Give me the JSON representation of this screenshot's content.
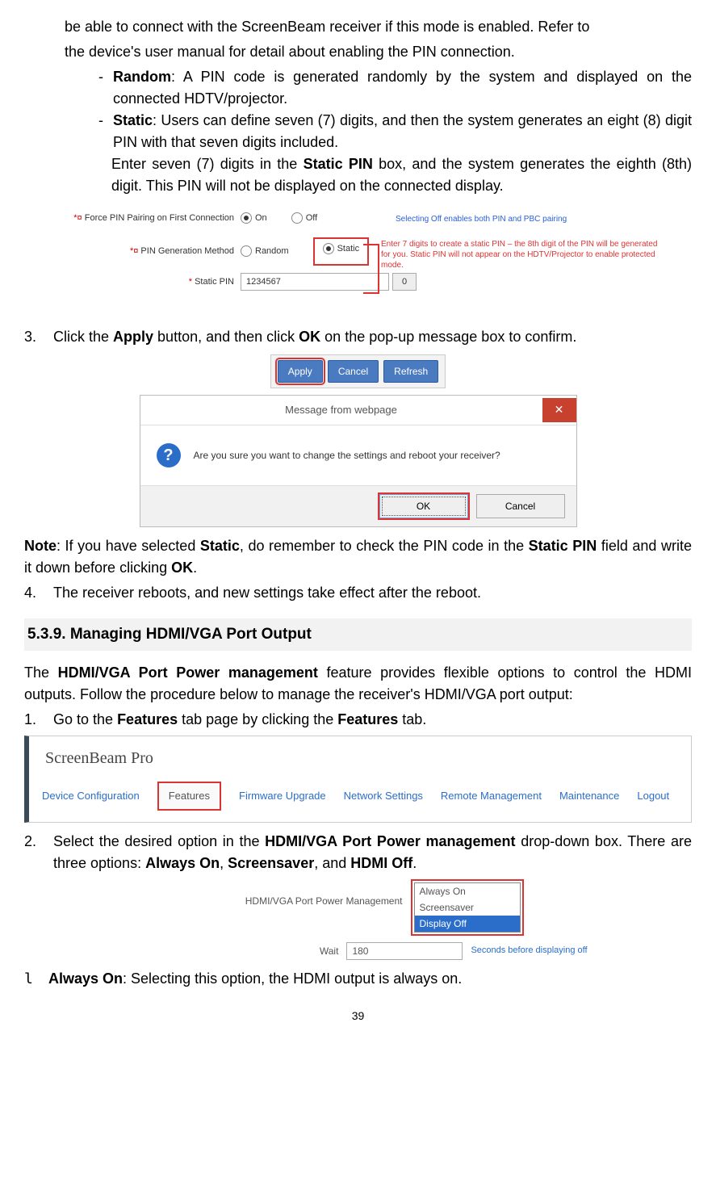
{
  "intro": {
    "line1": "be able to connect with the ScreenBeam receiver if this mode is enabled. Refer to",
    "line2": "the device's user manual for detail about enabling the PIN connection."
  },
  "random": {
    "dash": "-",
    "label": "Random",
    "text": ": A PIN code is generated randomly by the system and displayed on the connected HDTV/projector."
  },
  "static": {
    "dash": "-",
    "label": "Static",
    "text1": ": Users can define seven (7) digits, and then the system generates an eight (8) digit PIN with that seven digits included.",
    "text2a": "Enter seven (7) digits in the ",
    "boxlabel": "Static PIN",
    "text2b": " box, and the system generates the eighth (8th) digit. This PIN will not be displayed on the connected display."
  },
  "pinfig": {
    "row1label": "Force PIN Pairing on First Connection",
    "on": "On",
    "off": "Off",
    "bluenote": "Selecting Off enables both PIN and PBC pairing",
    "row2label": "PIN Generation Method",
    "random": "Random",
    "static": "Static",
    "row3label": "Static PIN",
    "pinval": "1234567",
    "eighth": "0",
    "redtext": "Enter 7 digits to create a static PIN – the 8th digit of the PIN will be generated for you. Static PIN will not appear on the HDTV/Projector to enable protected mode."
  },
  "step3": {
    "num": "3.",
    "a": "Click the ",
    "apply": "Apply",
    "b": " button, and then click ",
    "ok": "OK",
    "c": " on the pop-up message box to confirm."
  },
  "btns": {
    "apply": "Apply",
    "cancel": "Cancel",
    "refresh": "Refresh"
  },
  "msg": {
    "title": "Message from webpage",
    "x": "✕",
    "q": "?",
    "text": "Are you sure you want to change the settings and reboot your receiver?",
    "ok": "OK",
    "cancel": "Cancel"
  },
  "note": {
    "label": "Note",
    "a": ": If you have selected ",
    "static": "Static",
    "b": ", do remember to check the PIN code in the ",
    "staticpin": "Static PIN",
    "c": " field and write it down before clicking ",
    "ok": "OK",
    "d": "."
  },
  "step4": {
    "num": "4.",
    "text": "The receiver reboots, and new settings take effect after the reboot."
  },
  "section": "5.3.9.   Managing HDMI/VGA Port Output",
  "sectext": {
    "a": "The ",
    "feat": "HDMI/VGA Port Power management",
    "b": " feature provides flexible options to control the HDMI outputs. Follow the procedure below to manage the receiver's HDMI/VGA port output:"
  },
  "s1": {
    "num": "1.",
    "a": "Go to the ",
    "feat": "Features",
    "b": " tab page by clicking the ",
    "feat2": "Features",
    "c": " tab."
  },
  "tabs": {
    "brand": "ScreenBeam Pro",
    "t1": "Device Configuration",
    "t2": "Features",
    "t3": "Firmware Upgrade",
    "t4": "Network Settings",
    "t5": "Remote Management",
    "t6": "Maintenance",
    "t7": "Logout"
  },
  "s2": {
    "num": "2.",
    "a": "Select the desired option in the ",
    "feat": "HDMI/VGA Port Power management",
    "b": " drop-down box. There are three options: ",
    "o1": "Always On",
    "c": ", ",
    "o2": "Screensaver",
    "d": ", and ",
    "o3": "HDMI Off",
    "e": "."
  },
  "pw": {
    "label": "HDMI/VGA Port Power Management",
    "opt1": "Always On",
    "opt2": "Screensaver",
    "opt3": "Display Off",
    "wait": "Wait",
    "waitval": "180",
    "note": "Seconds before displaying off"
  },
  "always": {
    "glyph": "l",
    "label": "Always On",
    "text": ": Selecting this option, the HDMI output is always on."
  },
  "pagenum": "39"
}
